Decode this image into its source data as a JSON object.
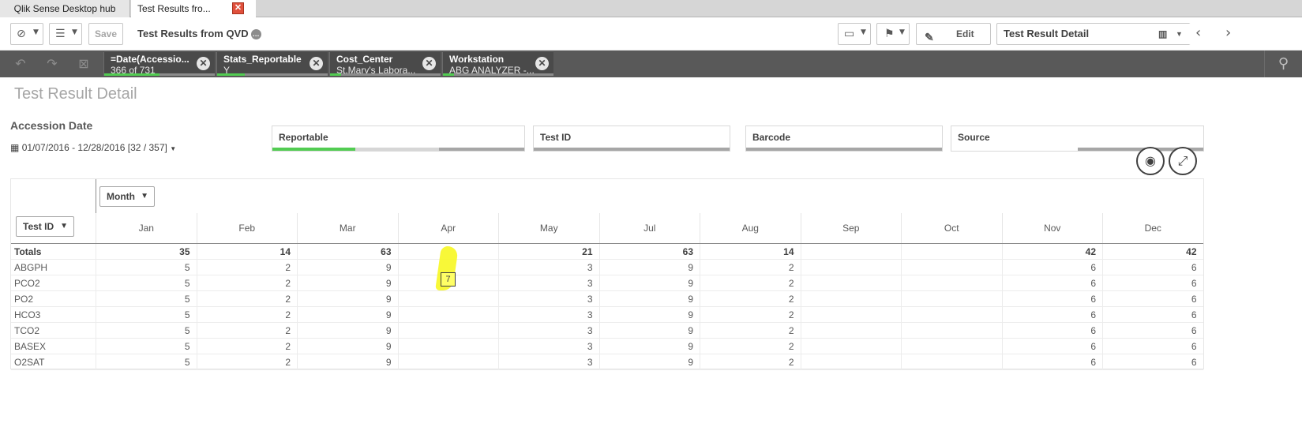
{
  "tabs": [
    {
      "label": "Qlik Sense Desktop hub"
    },
    {
      "label": "Test Results fro..."
    }
  ],
  "toolbar": {
    "save_label": "Save",
    "app_title": "Test Results from QVD",
    "edit_label": "Edit",
    "sheet_name": "Test Result Detail"
  },
  "selections": [
    {
      "field": "=Date(Accessio...",
      "value": "366 of 731",
      "green_fraction": 0.5
    },
    {
      "field": "Stats_Reportable",
      "value": "Y",
      "green_fraction": 0.25
    },
    {
      "field": "Cost_Center",
      "value": "St.Mary's Labora...",
      "green_fraction": 0.1
    },
    {
      "field": "Workstation",
      "value": "ABG ANALYZER -...",
      "green_fraction": 0.1
    }
  ],
  "sheet": {
    "title": "Test Result Detail",
    "accession_label": "Accession Date",
    "accession_value": "01/07/2016 - 12/28/2016 [32 / 357]"
  },
  "filters": [
    {
      "label": "Reportable"
    },
    {
      "label": "Test ID"
    },
    {
      "label": "Barcode"
    },
    {
      "label": "Source"
    }
  ],
  "pivot": {
    "row_dim": "Test ID",
    "col_dim": "Month",
    "months": [
      "Jan",
      "Feb",
      "Mar",
      "Apr",
      "May",
      "Jul",
      "Aug",
      "Sep",
      "Oct",
      "Nov",
      "Dec"
    ],
    "rows": [
      {
        "label": "Totals",
        "values": [
          "35",
          "14",
          "63",
          "",
          "21",
          "63",
          "14",
          "",
          "",
          "42",
          "42"
        ]
      },
      {
        "label": "ABGPH",
        "values": [
          "5",
          "2",
          "9",
          "",
          "3",
          "9",
          "2",
          "",
          "",
          "6",
          "6"
        ]
      },
      {
        "label": "PCO2",
        "values": [
          "5",
          "2",
          "9",
          "",
          "3",
          "9",
          "2",
          "",
          "",
          "6",
          "6"
        ]
      },
      {
        "label": "PO2",
        "values": [
          "5",
          "2",
          "9",
          "",
          "3",
          "9",
          "2",
          "",
          "",
          "6",
          "6"
        ]
      },
      {
        "label": "HCO3",
        "values": [
          "5",
          "2",
          "9",
          "",
          "3",
          "9",
          "2",
          "",
          "",
          "6",
          "6"
        ]
      },
      {
        "label": "TCO2",
        "values": [
          "5",
          "2",
          "9",
          "",
          "3",
          "9",
          "2",
          "",
          "",
          "6",
          "6"
        ]
      },
      {
        "label": "BASEX",
        "values": [
          "5",
          "2",
          "9",
          "",
          "3",
          "9",
          "2",
          "",
          "",
          "6",
          "6"
        ]
      },
      {
        "label": "O2SAT",
        "values": [
          "5",
          "2",
          "9",
          "",
          "3",
          "9",
          "2",
          "",
          "",
          "6",
          "6"
        ]
      }
    ],
    "annotation_value": "7"
  }
}
